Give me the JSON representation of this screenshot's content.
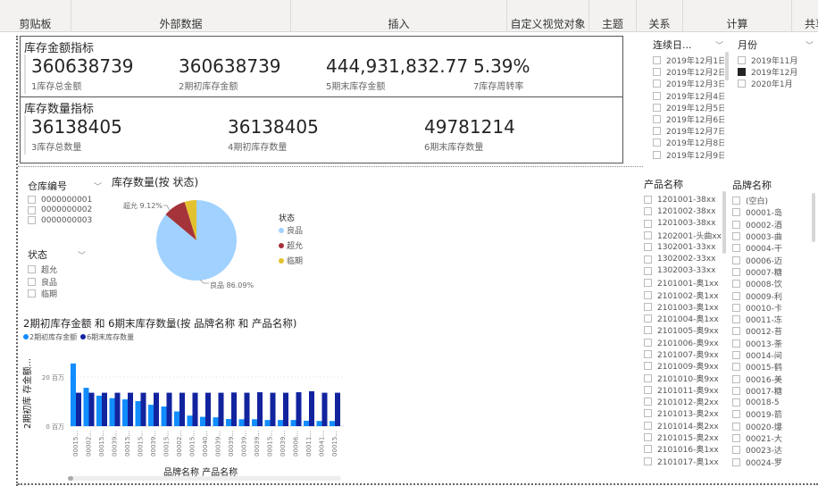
{
  "ribbon": {
    "groups": [
      "剪贴板",
      "外部数据",
      "插入",
      "自定义视觉对象",
      "主题",
      "关系",
      "计算",
      "共享"
    ]
  },
  "amount_card": {
    "title": "库存金额指标",
    "kpis": [
      {
        "value": "360638739",
        "label": "1库存总金额"
      },
      {
        "value": "360638739",
        "label": "2期初库存金额"
      },
      {
        "value": "444,931,832.77",
        "label": "5期末库存金额"
      },
      {
        "value": "5.39%",
        "label": "7库存周转率"
      }
    ]
  },
  "qty_card": {
    "title": "库存数量指标",
    "kpis": [
      {
        "value": "36138405",
        "label": "3库存总数量"
      },
      {
        "value": "36138405",
        "label": "4期初库存数量"
      },
      {
        "value": "49781214",
        "label": "6期末库存数量"
      }
    ]
  },
  "date_slicer": {
    "title": "连续日...",
    "items": [
      "2019年12月1日",
      "2019年12月2日",
      "2019年12月3日",
      "2019年12月4日",
      "2019年12月5日",
      "2019年12月6日",
      "2019年12月7日",
      "2019年12月8日",
      "2019年12月9日"
    ]
  },
  "month_slicer": {
    "title": "月份",
    "items": [
      {
        "label": "2019年11月",
        "checked": false
      },
      {
        "label": "2019年12月",
        "checked": true
      },
      {
        "label": "2020年1月",
        "checked": false
      }
    ]
  },
  "warehouse_slicer": {
    "title": "仓库编号",
    "items": [
      "0000000001",
      "0000000002",
      "0000000003"
    ]
  },
  "status_slicer": {
    "title": "状态",
    "items": [
      "超允",
      "良品",
      "临期"
    ]
  },
  "product_slicer": {
    "title": "产品名称",
    "items": [
      "1201001-38xx",
      "1201002-38xx",
      "1201003-38xx",
      "1202001-头曲xx",
      "1302001-33xx",
      "1302002-33xx",
      "1302003-33xx",
      "2101001-奥1xx",
      "2101002-奥1xx",
      "2101003-奥1xx",
      "2101004-奥1xx",
      "2101005-奥9xx",
      "2101006-奥9xx",
      "2101007-奥9xx",
      "2101009-奥9xx",
      "2101010-奥9xx",
      "2101011-奥9xx",
      "2101012-奥2xx",
      "2101013-奥2xx",
      "2101014-奥2xx",
      "2101015-奥2xx",
      "2101016-奥1xx",
      "2101017-奥1xx"
    ]
  },
  "brand_slicer": {
    "title": "品牌名称",
    "items": [
      "(空白)",
      "00001-岛",
      "00002-酒",
      "00003-曲",
      "00004-干",
      "00006-迈",
      "00007-糖",
      "00008-饮",
      "00009-利",
      "00010-卡",
      "00011-冻",
      "00012-苔",
      "00013-荼",
      "00014-间",
      "00015-鹤",
      "00016-美",
      "00017-糖",
      "00018-5",
      "00019-箭",
      "00020-爆",
      "00021-大",
      "00023-达",
      "00024-罗"
    ]
  },
  "chart_data": [
    {
      "type": "pie",
      "title": "库存数量(按 状态)",
      "legend_title": "状态",
      "legend_placement": "right",
      "slices": [
        {
          "name": "良品",
          "value": 86.09,
          "label": "良品 86.09%",
          "color": "#a0d1ff"
        },
        {
          "name": "超允",
          "value": 9.12,
          "label": "超允 9.12%",
          "color": "#a4343a"
        },
        {
          "name": "临期",
          "value": 4.79,
          "color": "#e3c12f"
        }
      ]
    },
    {
      "type": "bar",
      "title": "2期初库存金额 和 6期末库存数量(按 品牌名称 和 产品名称)",
      "xlabel": "品牌名称 产品名称",
      "ylabel": "2期初库 存金额...",
      "ylim": [
        0,
        27
      ],
      "yticks": [
        {
          "v": 0,
          "label": "0 百万"
        },
        {
          "v": 20,
          "label": "20 百万"
        }
      ],
      "categories": [
        "00015...",
        "00002...",
        "00015...",
        "00039...",
        "00015...",
        "00015...",
        "00039...",
        "00015...",
        "00002...",
        "00015...",
        "00040...",
        "00039...",
        "00039...",
        "00039...",
        "00039...",
        "00015...",
        "00039...",
        "00006...",
        "00011...",
        "00041...",
        "00015..."
      ],
      "series": [
        {
          "name": "2期初库存金额",
          "color": "#118dff",
          "values": [
            25.5,
            15.6,
            12.4,
            11.4,
            10.9,
            10.2,
            8.7,
            8.0,
            6.0,
            4.3,
            3.8,
            3.6,
            2.9,
            2.8,
            2.8,
            2.5,
            2.5,
            2.5,
            2.2,
            2.1,
            2.1
          ]
        },
        {
          "name": "6期末库存数量",
          "color": "#12239e",
          "values": [
            13.6,
            13.6,
            13.6,
            13.6,
            13.6,
            13.6,
            13.6,
            13.6,
            13.6,
            13.6,
            13.6,
            13.6,
            13.7,
            13.6,
            13.8,
            13.6,
            13.6,
            13.8,
            14.2,
            13.6,
            13.6
          ]
        }
      ]
    }
  ]
}
